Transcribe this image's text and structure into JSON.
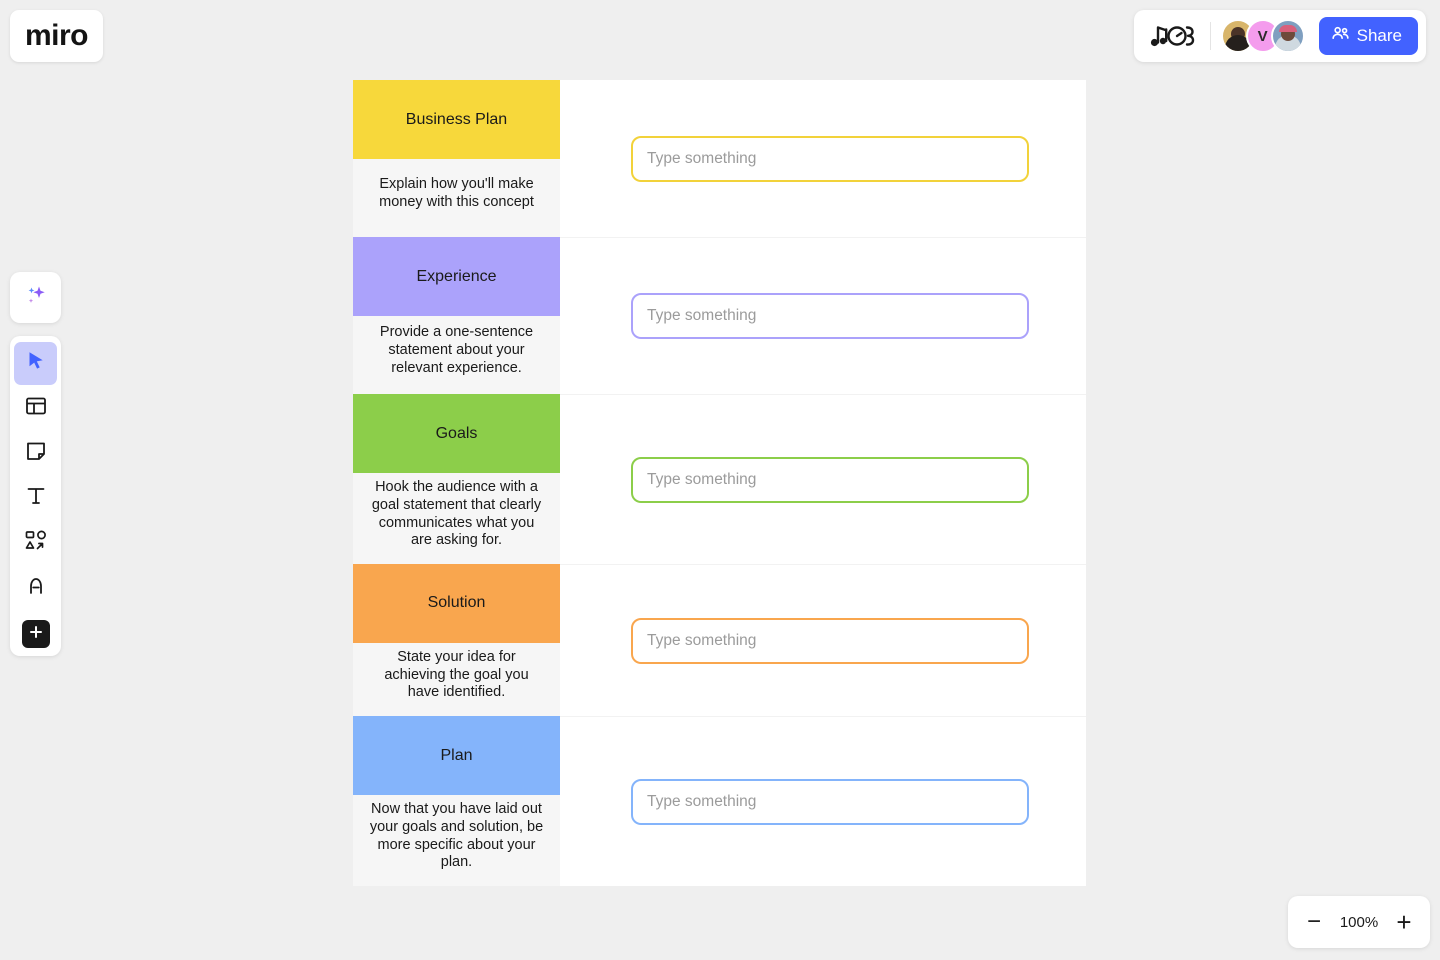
{
  "app": {
    "logo_text": "miro"
  },
  "topbar": {
    "doodle_icon": "music-notes-doodle-icon",
    "share_label": "Share",
    "share_icon": "people-icon",
    "share_color": "#4262ff",
    "collaborators": [
      {
        "name": "avatar-photo-1",
        "initial": "",
        "type": "photo"
      },
      {
        "name": "avatar-initial-v",
        "initial": "V",
        "type": "initial"
      },
      {
        "name": "avatar-photo-3",
        "initial": "",
        "type": "photo"
      }
    ]
  },
  "toolbar": {
    "ai_icon": "sparkles-icon",
    "items": [
      {
        "icon": "cursor-select-icon",
        "name": "select-tool",
        "active": true
      },
      {
        "icon": "template-frame-icon",
        "name": "template-tool",
        "active": false
      },
      {
        "icon": "sticky-note-icon",
        "name": "sticky-note-tool",
        "active": false
      },
      {
        "icon": "text-icon",
        "name": "text-tool",
        "active": false
      },
      {
        "icon": "shapes-connector-icon",
        "name": "shapes-tool",
        "active": false
      },
      {
        "icon": "pen-icon",
        "name": "pen-tool",
        "active": false
      },
      {
        "icon": "plus-icon",
        "name": "more-apps-tool",
        "active": false
      }
    ]
  },
  "board": {
    "input_placeholder": "Type something",
    "rows": [
      {
        "title": "Business Plan",
        "description": "Explain how you'll make money with this concept",
        "color": "#F7D83B",
        "border_color": "#F2D23A"
      },
      {
        "title": "Experience",
        "description": "Provide a one-sentence statement about your relevant experience.",
        "color": "#ABA2FB",
        "border_color": "#ABA2FB"
      },
      {
        "title": "Goals",
        "description": "Hook the audience with a goal statement that clearly communicates what you are asking for.",
        "color": "#8CCE4A",
        "border_color": "#8CCE4A"
      },
      {
        "title": "Solution",
        "description": "State your idea for achieving the goal you have identified.",
        "color": "#F9A64E",
        "border_color": "#F9A64E"
      },
      {
        "title": "Plan",
        "description": "Now that you have laid out your goals and solution, be more specific about your plan.",
        "color": "#84B4FB",
        "border_color": "#84B4FB"
      }
    ]
  },
  "zoom": {
    "level": "100%",
    "minus_label": "−",
    "plus_label": "+"
  }
}
